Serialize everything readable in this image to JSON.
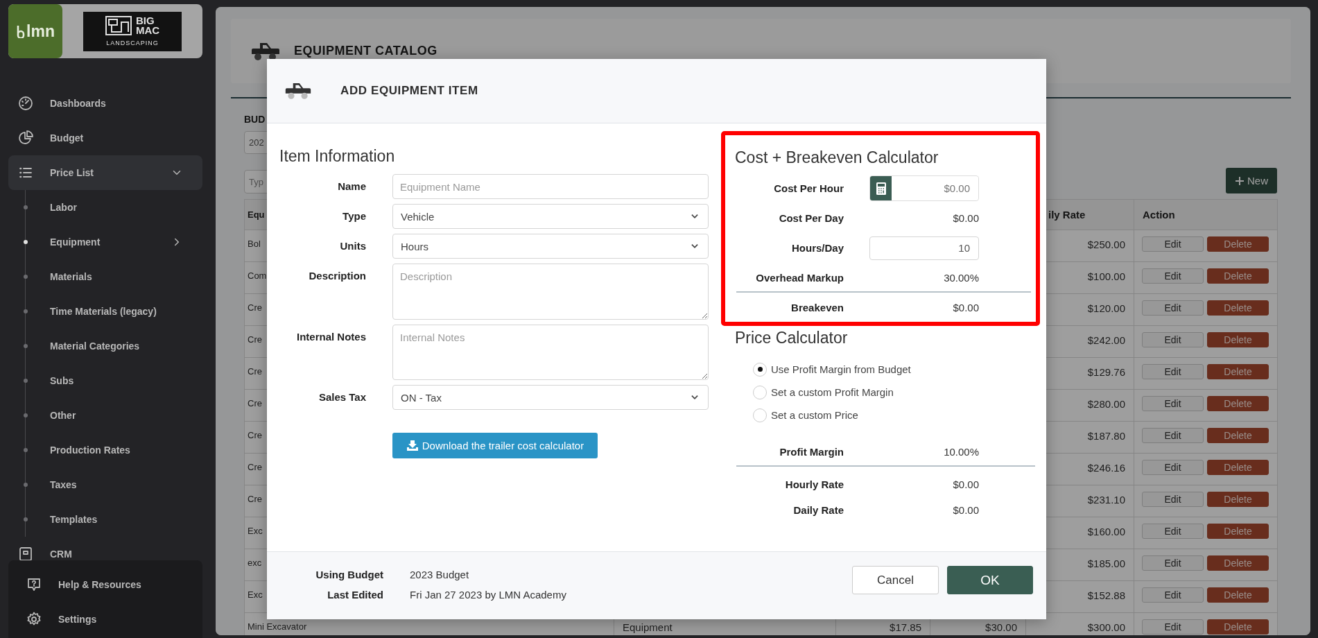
{
  "sidebar": {
    "logo": {
      "app_name": "lmn",
      "company_lines": [
        "BIG",
        "MAC",
        "LANDSCAPING"
      ]
    },
    "nav_items": [
      {
        "label": "Dashboards",
        "expanded": false
      },
      {
        "label": "Budget",
        "expanded": false
      },
      {
        "label": "Price List",
        "expanded": true,
        "children": [
          {
            "label": "Labor",
            "selected": false,
            "submenu": false
          },
          {
            "label": "Equipment",
            "selected": true,
            "submenu": true
          },
          {
            "label": "Materials",
            "selected": false,
            "submenu": false
          },
          {
            "label": "Time Materials (legacy)",
            "selected": false,
            "submenu": false
          },
          {
            "label": "Material Categories",
            "selected": false,
            "submenu": false
          },
          {
            "label": "Subs",
            "selected": false,
            "submenu": false
          },
          {
            "label": "Other",
            "selected": false,
            "submenu": false
          },
          {
            "label": "Production Rates",
            "selected": false,
            "submenu": false
          },
          {
            "label": "Taxes",
            "selected": false,
            "submenu": false
          },
          {
            "label": "Templates",
            "selected": false,
            "submenu": false
          }
        ]
      },
      {
        "label": "CRM",
        "expanded": false
      }
    ],
    "footer_items": [
      {
        "label": "Help & Resources"
      },
      {
        "label": "Settings"
      }
    ]
  },
  "page": {
    "title": "EQUIPMENT CATALOG",
    "budget_label": "BUD",
    "budget_value": "202",
    "search_placeholder": "Typ",
    "new_button": "New",
    "table": {
      "header": {
        "column_1": "Equ",
        "column_5": "ily Rate",
        "column_6": "Action"
      },
      "rows": [
        {
          "column_1": "Bol",
          "column_5": "$250.00",
          "actions": [
            {
              "label": "Edit",
              "kind": "plain"
            },
            {
              "label": "Delete",
              "kind": "danger"
            }
          ]
        },
        {
          "column_1": "Com",
          "column_5": "$100.00",
          "actions": [
            {
              "label": "Edit",
              "kind": "plain"
            },
            {
              "label": "Delete",
              "kind": "danger"
            }
          ]
        },
        {
          "column_1": "Cre",
          "column_5": "$120.00",
          "actions": [
            {
              "label": "Edit",
              "kind": "plain"
            },
            {
              "label": "Delete",
              "kind": "danger"
            }
          ]
        },
        {
          "column_1": "Cre",
          "column_5": "$242.00",
          "actions": [
            {
              "label": "Edit",
              "kind": "plain"
            },
            {
              "label": "Delete",
              "kind": "danger"
            }
          ]
        },
        {
          "column_1": "Cre",
          "column_5": "$129.76",
          "actions": [
            {
              "label": "Edit",
              "kind": "plain"
            },
            {
              "label": "Delete",
              "kind": "danger"
            }
          ]
        },
        {
          "column_1": "Cre",
          "column_5": "$280.00",
          "actions": [
            {
              "label": "Edit",
              "kind": "plain"
            },
            {
              "label": "Delete",
              "kind": "danger"
            }
          ]
        },
        {
          "column_1": "Cre",
          "column_5": "$187.80",
          "actions": [
            {
              "label": "Edit",
              "kind": "plain"
            },
            {
              "label": "Delete",
              "kind": "danger"
            }
          ]
        },
        {
          "column_1": "Cre",
          "column_5": "$246.16",
          "actions": [
            {
              "label": "Edit",
              "kind": "plain"
            },
            {
              "label": "Delete",
              "kind": "danger"
            }
          ]
        },
        {
          "column_1": "Cre",
          "column_5": "$231.10",
          "actions": [
            {
              "label": "Edit",
              "kind": "plain"
            },
            {
              "label": "Delete",
              "kind": "danger"
            }
          ]
        },
        {
          "column_1": "Exc",
          "column_5": "$160.00",
          "actions": [
            {
              "label": "Edit",
              "kind": "plain"
            },
            {
              "label": "Delete",
              "kind": "danger"
            }
          ]
        },
        {
          "column_1": "exc",
          "column_5": "$185.00",
          "actions": [
            {
              "label": "Edit",
              "kind": "plain"
            },
            {
              "label": "Delete",
              "kind": "danger"
            }
          ]
        },
        {
          "column_1": "Exc",
          "column_5": "$152.88",
          "actions": [
            {
              "label": "Edit",
              "kind": "plain"
            },
            {
              "label": "Delete",
              "kind": "danger"
            }
          ]
        },
        {
          "column_1": "Mini Excavator",
          "column_2": "Equipment",
          "column_3": "$17.85",
          "column_4": "$30.00",
          "column_5": "$300.00",
          "actions": [
            {
              "label": "Edit",
              "kind": "plain"
            },
            {
              "label": "Delete",
              "kind": "danger"
            }
          ]
        }
      ]
    }
  },
  "modal": {
    "title": "ADD EQUIPMENT ITEM",
    "item_information": {
      "heading": "Item Information",
      "fields": [
        {
          "label": "Name",
          "kind": "text",
          "placeholder": "Equipment Name"
        },
        {
          "label": "Type",
          "kind": "select",
          "value": "Vehicle"
        },
        {
          "label": "Units",
          "kind": "select",
          "value": "Hours"
        },
        {
          "label": "Description",
          "kind": "textarea",
          "placeholder": "Description"
        },
        {
          "label": "Internal Notes",
          "kind": "textarea",
          "placeholder": "Internal Notes"
        },
        {
          "label": "Sales Tax",
          "kind": "select",
          "value": "ON - Tax"
        }
      ],
      "download_button": "Download the trailer cost calculator"
    },
    "cost_calculator": {
      "heading": "Cost + Breakeven Calculator",
      "highlighted": true,
      "rows": [
        {
          "label": "Cost Per Hour",
          "kind": "calculator_input",
          "placeholder": "$0.00",
          "rule_above": false
        },
        {
          "label": "Cost Per Day",
          "kind": "static",
          "value": "$0.00",
          "rule_above": false
        },
        {
          "label": "Hours/Day",
          "kind": "input",
          "value": "10",
          "rule_above": false
        },
        {
          "label": "Overhead Markup",
          "kind": "static",
          "value": "30.00%",
          "rule_above": false
        },
        {
          "label": "Breakeven",
          "kind": "static",
          "value": "$0.00",
          "rule_above": true
        }
      ]
    },
    "price_calculator": {
      "heading": "Price Calculator",
      "options": [
        {
          "label": "Use Profit Margin from Budget",
          "selected": true
        },
        {
          "label": "Set a custom Profit Margin",
          "selected": false
        },
        {
          "label": "Set a custom Price",
          "selected": false
        }
      ],
      "rows": [
        {
          "label": "Profit Margin",
          "kind": "static",
          "value": "10.00%",
          "rule_above": false
        },
        {
          "label": "Hourly Rate",
          "kind": "static",
          "value": "$0.00",
          "rule_above": true
        },
        {
          "label": "Daily Rate",
          "kind": "static",
          "value": "$0.00",
          "rule_above": false
        }
      ]
    },
    "footer": {
      "meta": [
        {
          "label": "Using Budget",
          "value": "2023 Budget"
        },
        {
          "label": "Last Edited",
          "value": "Fri Jan 27 2023 by LMN Academy"
        }
      ],
      "buttons": [
        {
          "label": "Cancel",
          "kind": "secondary"
        },
        {
          "label": "OK",
          "kind": "primary"
        }
      ]
    }
  }
}
